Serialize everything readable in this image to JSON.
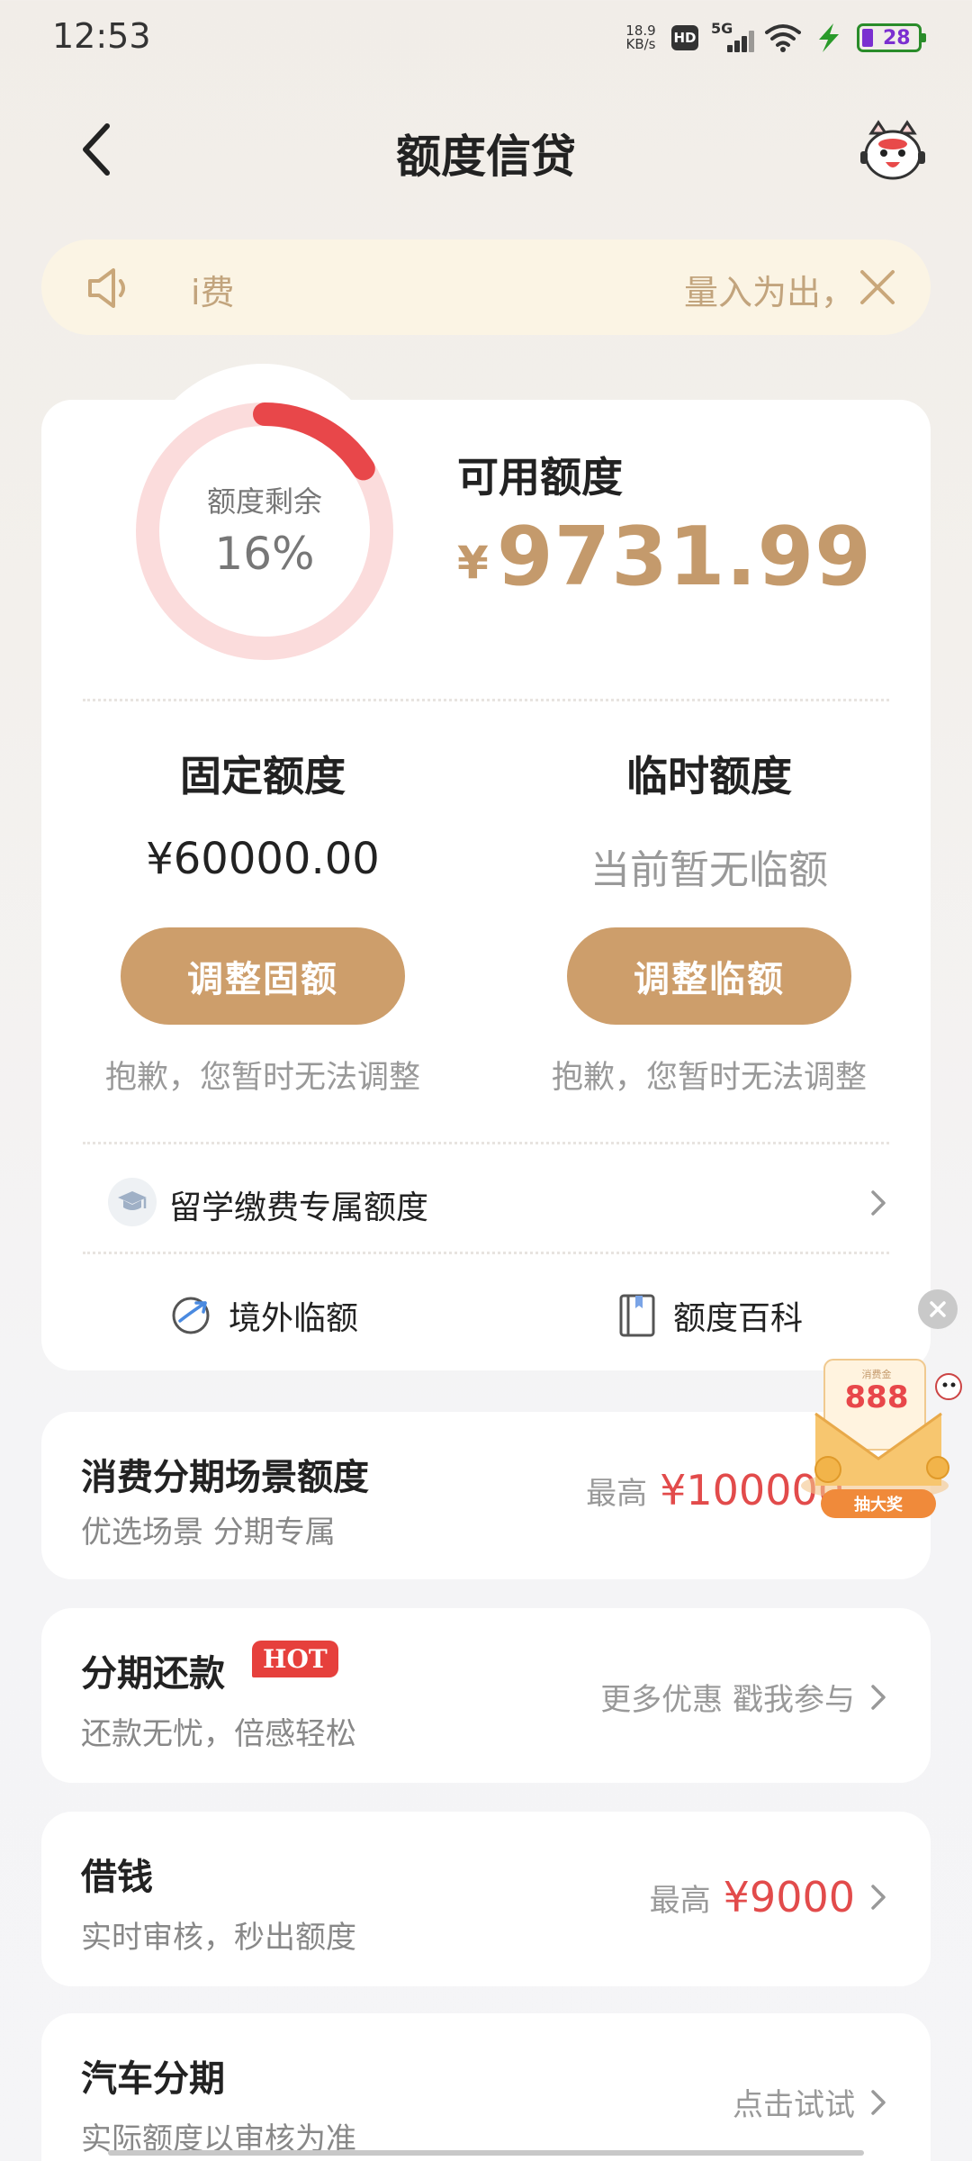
{
  "status_bar": {
    "time": "12:53",
    "net_speed_value": "18.9",
    "net_speed_unit": "KB/s",
    "hd": "HD",
    "network": "5G",
    "battery": "28"
  },
  "header": {
    "title": "额度信贷"
  },
  "notice": {
    "left_text": "i费",
    "right_text": "量入为出，"
  },
  "quota_ring": {
    "label": "额度剩余",
    "value": "16%",
    "fraction": 0.16,
    "track_color": "#fbdcdc",
    "progress_color": "#e8474a"
  },
  "available": {
    "label": "可用额度",
    "currency": "¥",
    "amount": "9731.99"
  },
  "fixed": {
    "title": "固定额度",
    "value": "¥60000.00",
    "button": "调整固额",
    "note": "抱歉，您暂时无法调整"
  },
  "temporary": {
    "title": "临时额度",
    "value": "当前暂无临额",
    "button": "调整临额",
    "note": "抱歉，您暂时无法调整"
  },
  "study_row": {
    "label": "留学缴费专属额度"
  },
  "tools": {
    "overseas": "境外临额",
    "wiki": "额度百科"
  },
  "promo": {
    "top_label": "消费金",
    "amount": "888",
    "badge": "抽大奖"
  },
  "cards": {
    "installment_scene": {
      "title": "消费分期场景额度",
      "sub": "优选场景 分期专属",
      "right_prefix": "最高",
      "right_amount": "¥100000"
    },
    "installment_repay": {
      "title": "分期还款",
      "hot": "HOT",
      "sub": "还款无忧，倍感轻松",
      "right": "更多优惠 戳我参与"
    },
    "borrow": {
      "title": "借钱",
      "sub": "实时审核，秒出额度",
      "right_prefix": "最高",
      "right_amount": "¥9000"
    },
    "car": {
      "title": "汽车分期",
      "sub": "实际额度以审核为准",
      "right": "点击试试"
    }
  },
  "colors": {
    "accent_gold": "#c49a6c",
    "button_gold": "#cd9e6b",
    "notice_bg": "#fbf4e4",
    "red": "#e24b4b"
  }
}
